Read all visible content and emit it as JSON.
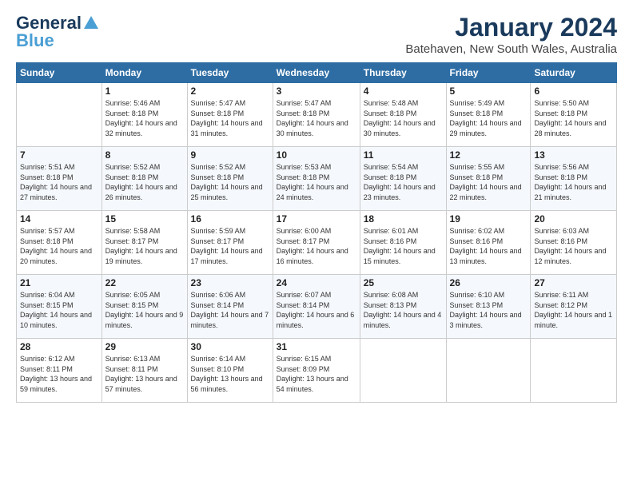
{
  "logo": {
    "line1": "General",
    "line2": "Blue"
  },
  "title": "January 2024",
  "subtitle": "Batehaven, New South Wales, Australia",
  "weekdays": [
    "Sunday",
    "Monday",
    "Tuesday",
    "Wednesday",
    "Thursday",
    "Friday",
    "Saturday"
  ],
  "weeks": [
    [
      {
        "day": "",
        "sunrise": "",
        "sunset": "",
        "daylight": ""
      },
      {
        "day": "1",
        "sunrise": "Sunrise: 5:46 AM",
        "sunset": "Sunset: 8:18 PM",
        "daylight": "Daylight: 14 hours and 32 minutes."
      },
      {
        "day": "2",
        "sunrise": "Sunrise: 5:47 AM",
        "sunset": "Sunset: 8:18 PM",
        "daylight": "Daylight: 14 hours and 31 minutes."
      },
      {
        "day": "3",
        "sunrise": "Sunrise: 5:47 AM",
        "sunset": "Sunset: 8:18 PM",
        "daylight": "Daylight: 14 hours and 30 minutes."
      },
      {
        "day": "4",
        "sunrise": "Sunrise: 5:48 AM",
        "sunset": "Sunset: 8:18 PM",
        "daylight": "Daylight: 14 hours and 30 minutes."
      },
      {
        "day": "5",
        "sunrise": "Sunrise: 5:49 AM",
        "sunset": "Sunset: 8:18 PM",
        "daylight": "Daylight: 14 hours and 29 minutes."
      },
      {
        "day": "6",
        "sunrise": "Sunrise: 5:50 AM",
        "sunset": "Sunset: 8:18 PM",
        "daylight": "Daylight: 14 hours and 28 minutes."
      }
    ],
    [
      {
        "day": "7",
        "sunrise": "Sunrise: 5:51 AM",
        "sunset": "Sunset: 8:18 PM",
        "daylight": "Daylight: 14 hours and 27 minutes."
      },
      {
        "day": "8",
        "sunrise": "Sunrise: 5:52 AM",
        "sunset": "Sunset: 8:18 PM",
        "daylight": "Daylight: 14 hours and 26 minutes."
      },
      {
        "day": "9",
        "sunrise": "Sunrise: 5:52 AM",
        "sunset": "Sunset: 8:18 PM",
        "daylight": "Daylight: 14 hours and 25 minutes."
      },
      {
        "day": "10",
        "sunrise": "Sunrise: 5:53 AM",
        "sunset": "Sunset: 8:18 PM",
        "daylight": "Daylight: 14 hours and 24 minutes."
      },
      {
        "day": "11",
        "sunrise": "Sunrise: 5:54 AM",
        "sunset": "Sunset: 8:18 PM",
        "daylight": "Daylight: 14 hours and 23 minutes."
      },
      {
        "day": "12",
        "sunrise": "Sunrise: 5:55 AM",
        "sunset": "Sunset: 8:18 PM",
        "daylight": "Daylight: 14 hours and 22 minutes."
      },
      {
        "day": "13",
        "sunrise": "Sunrise: 5:56 AM",
        "sunset": "Sunset: 8:18 PM",
        "daylight": "Daylight: 14 hours and 21 minutes."
      }
    ],
    [
      {
        "day": "14",
        "sunrise": "Sunrise: 5:57 AM",
        "sunset": "Sunset: 8:18 PM",
        "daylight": "Daylight: 14 hours and 20 minutes."
      },
      {
        "day": "15",
        "sunrise": "Sunrise: 5:58 AM",
        "sunset": "Sunset: 8:17 PM",
        "daylight": "Daylight: 14 hours and 19 minutes."
      },
      {
        "day": "16",
        "sunrise": "Sunrise: 5:59 AM",
        "sunset": "Sunset: 8:17 PM",
        "daylight": "Daylight: 14 hours and 17 minutes."
      },
      {
        "day": "17",
        "sunrise": "Sunrise: 6:00 AM",
        "sunset": "Sunset: 8:17 PM",
        "daylight": "Daylight: 14 hours and 16 minutes."
      },
      {
        "day": "18",
        "sunrise": "Sunrise: 6:01 AM",
        "sunset": "Sunset: 8:16 PM",
        "daylight": "Daylight: 14 hours and 15 minutes."
      },
      {
        "day": "19",
        "sunrise": "Sunrise: 6:02 AM",
        "sunset": "Sunset: 8:16 PM",
        "daylight": "Daylight: 14 hours and 13 minutes."
      },
      {
        "day": "20",
        "sunrise": "Sunrise: 6:03 AM",
        "sunset": "Sunset: 8:16 PM",
        "daylight": "Daylight: 14 hours and 12 minutes."
      }
    ],
    [
      {
        "day": "21",
        "sunrise": "Sunrise: 6:04 AM",
        "sunset": "Sunset: 8:15 PM",
        "daylight": "Daylight: 14 hours and 10 minutes."
      },
      {
        "day": "22",
        "sunrise": "Sunrise: 6:05 AM",
        "sunset": "Sunset: 8:15 PM",
        "daylight": "Daylight: 14 hours and 9 minutes."
      },
      {
        "day": "23",
        "sunrise": "Sunrise: 6:06 AM",
        "sunset": "Sunset: 8:14 PM",
        "daylight": "Daylight: 14 hours and 7 minutes."
      },
      {
        "day": "24",
        "sunrise": "Sunrise: 6:07 AM",
        "sunset": "Sunset: 8:14 PM",
        "daylight": "Daylight: 14 hours and 6 minutes."
      },
      {
        "day": "25",
        "sunrise": "Sunrise: 6:08 AM",
        "sunset": "Sunset: 8:13 PM",
        "daylight": "Daylight: 14 hours and 4 minutes."
      },
      {
        "day": "26",
        "sunrise": "Sunrise: 6:10 AM",
        "sunset": "Sunset: 8:13 PM",
        "daylight": "Daylight: 14 hours and 3 minutes."
      },
      {
        "day": "27",
        "sunrise": "Sunrise: 6:11 AM",
        "sunset": "Sunset: 8:12 PM",
        "daylight": "Daylight: 14 hours and 1 minute."
      }
    ],
    [
      {
        "day": "28",
        "sunrise": "Sunrise: 6:12 AM",
        "sunset": "Sunset: 8:11 PM",
        "daylight": "Daylight: 13 hours and 59 minutes."
      },
      {
        "day": "29",
        "sunrise": "Sunrise: 6:13 AM",
        "sunset": "Sunset: 8:11 PM",
        "daylight": "Daylight: 13 hours and 57 minutes."
      },
      {
        "day": "30",
        "sunrise": "Sunrise: 6:14 AM",
        "sunset": "Sunset: 8:10 PM",
        "daylight": "Daylight: 13 hours and 56 minutes."
      },
      {
        "day": "31",
        "sunrise": "Sunrise: 6:15 AM",
        "sunset": "Sunset: 8:09 PM",
        "daylight": "Daylight: 13 hours and 54 minutes."
      },
      {
        "day": "",
        "sunrise": "",
        "sunset": "",
        "daylight": ""
      },
      {
        "day": "",
        "sunrise": "",
        "sunset": "",
        "daylight": ""
      },
      {
        "day": "",
        "sunrise": "",
        "sunset": "",
        "daylight": ""
      }
    ]
  ]
}
